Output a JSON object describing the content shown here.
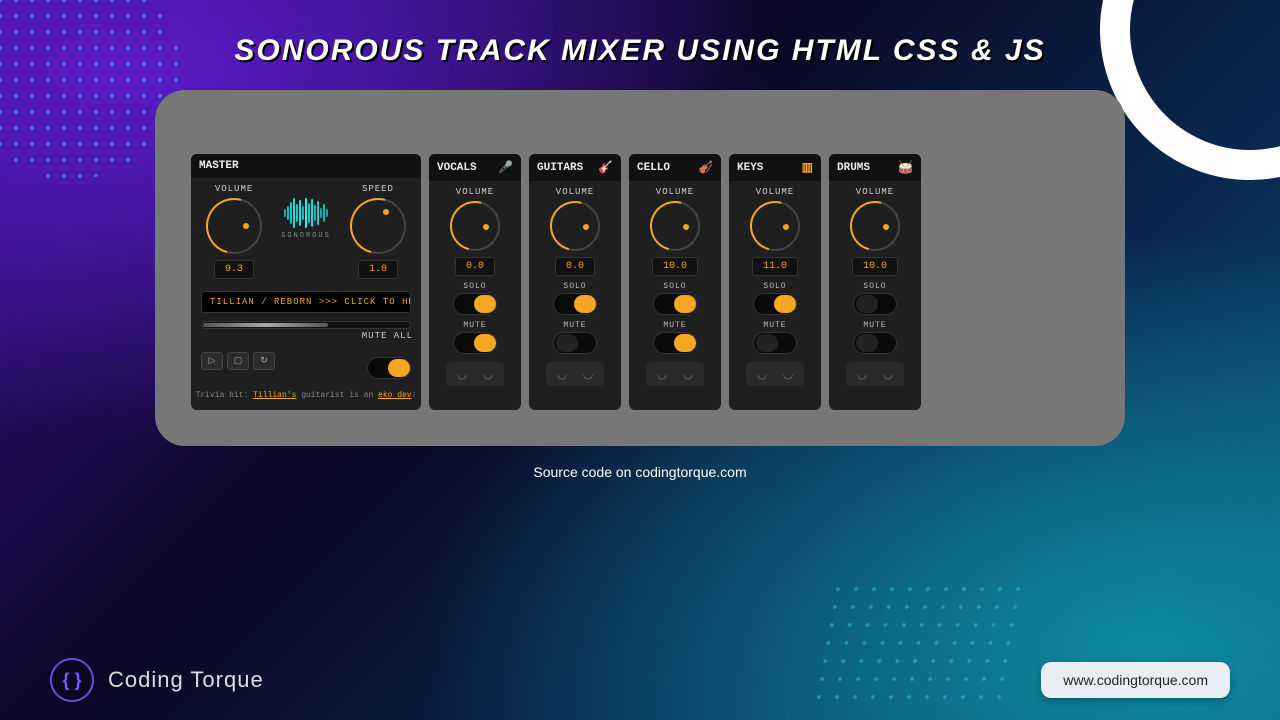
{
  "page": {
    "title": "SONOROUS TRACK MIXER USING HTML CSS & JS",
    "source_note": "Source code on codingtorque.com"
  },
  "brand": {
    "name": "Coding Torque",
    "logo_text": "{ }",
    "site": "www.codingtorque.com"
  },
  "master": {
    "title": "MASTER",
    "volume_label": "VOLUME",
    "volume_value": "9.3",
    "speed_label": "SPEED",
    "speed_value": "1.0",
    "waveform_label": "SONOROUS",
    "ticker": "TILLIAN / REBORN >>> CLICK TO HEA",
    "mute_all_label": "MUTE ALL",
    "mute_all_on": true,
    "transport": {
      "play": "▷",
      "stop": "▢",
      "loop": "↻"
    },
    "trivia_prefix": "Trivia bit: ",
    "trivia_link1": "Tillian's",
    "trivia_mid": " guitarist is an ",
    "trivia_link2": "eko dev",
    "trivia_suffix": "!"
  },
  "tracks": [
    {
      "title": "VOCALS",
      "icon": "mic-icon",
      "glyph": "🎤",
      "volume_label": "VOLUME",
      "volume": "0.0",
      "solo_label": "SOLO",
      "solo_on": true,
      "mute_label": "MUTE",
      "mute_on": true
    },
    {
      "title": "GUITARS",
      "icon": "guitar-icon",
      "glyph": "🎸",
      "volume_label": "VOLUME",
      "volume": "0.0",
      "solo_label": "SOLO",
      "solo_on": true,
      "mute_label": "MUTE",
      "mute_on": false
    },
    {
      "title": "CELLO",
      "icon": "violin-icon",
      "glyph": "🎻",
      "volume_label": "VOLUME",
      "volume": "10.0",
      "solo_label": "SOLO",
      "solo_on": true,
      "mute_label": "MUTE",
      "mute_on": true
    },
    {
      "title": "KEYS",
      "icon": "keys-icon",
      "glyph": "▥",
      "volume_label": "VOLUME",
      "volume": "11.0",
      "solo_label": "SOLO",
      "solo_on": true,
      "mute_label": "MUTE",
      "mute_on": false
    },
    {
      "title": "DRUMS",
      "icon": "drum-icon",
      "glyph": "🥁",
      "volume_label": "VOLUME",
      "volume": "10.0",
      "solo_label": "SOLO",
      "solo_on": false,
      "mute_label": "MUTE",
      "mute_on": false
    }
  ]
}
